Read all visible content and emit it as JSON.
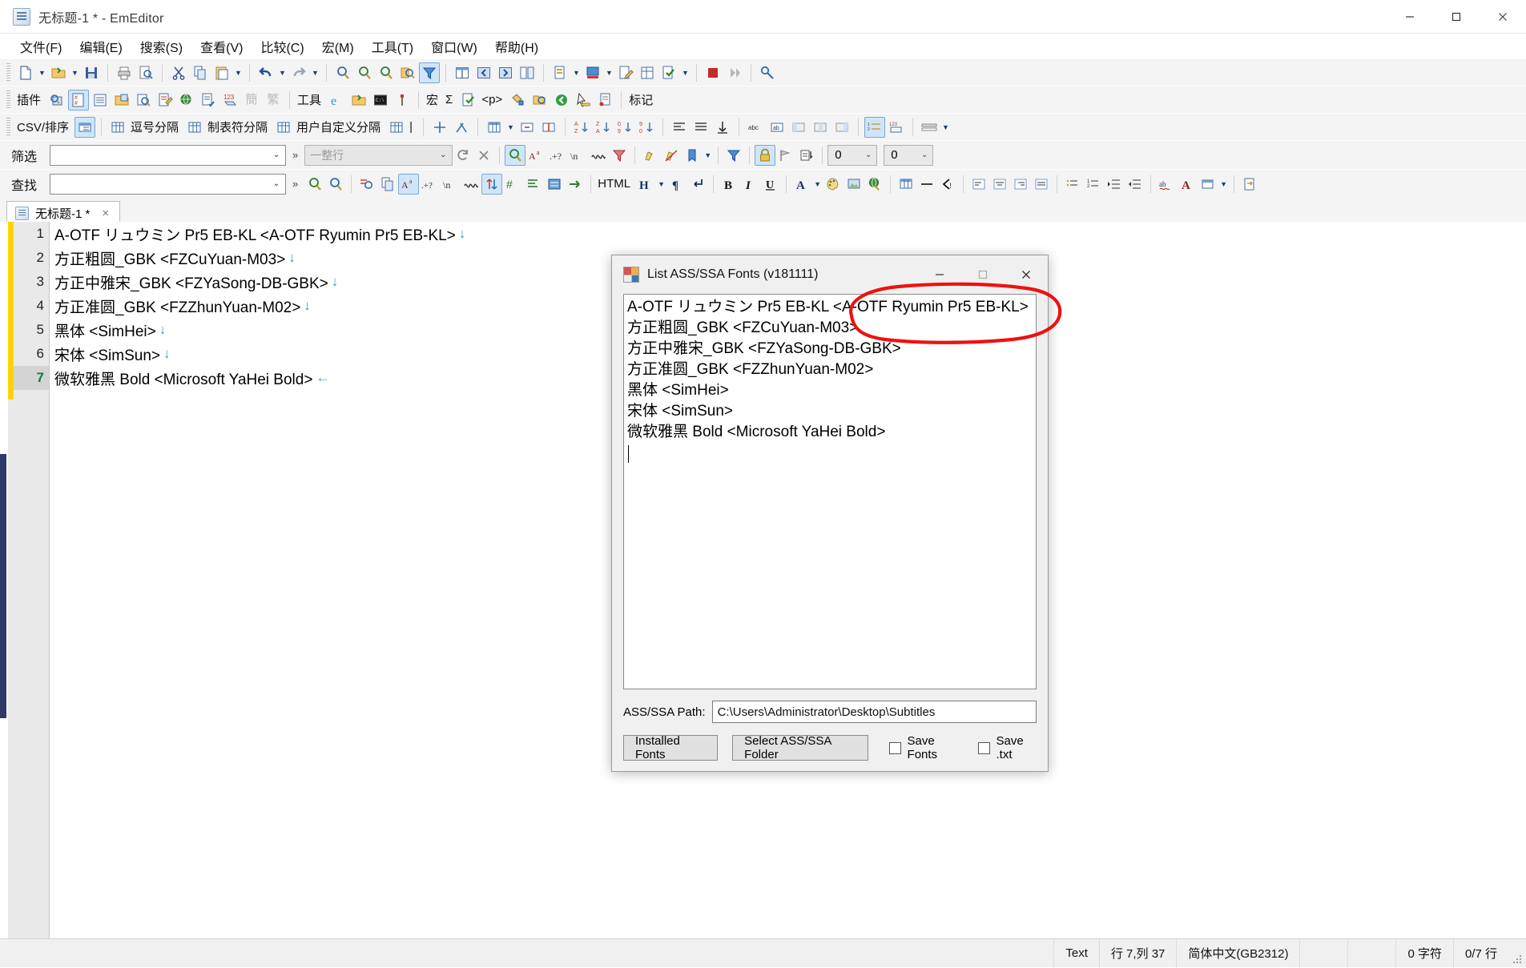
{
  "window": {
    "title": "无标题-1 * - EmEditor",
    "icon": "notepad-icon",
    "minimize": "minimize",
    "maximize": "maximize",
    "close": "close"
  },
  "menubar": {
    "items": [
      {
        "label": "文件(F)"
      },
      {
        "label": "编辑(E)"
      },
      {
        "label": "搜索(S)"
      },
      {
        "label": "查看(V)"
      },
      {
        "label": "比较(C)"
      },
      {
        "label": "宏(M)"
      },
      {
        "label": "工具(T)"
      },
      {
        "label": "窗口(W)"
      },
      {
        "label": "帮助(H)"
      }
    ]
  },
  "toolbar_standard": {
    "icons": [
      "new-file-icon",
      "new-file-dropdown",
      "open-folder-icon",
      "open-dropdown",
      "save-icon",
      "print-icon",
      "print-preview-icon",
      "cut-icon",
      "copy-icon",
      "paste-icon",
      "paste-dropdown",
      "undo-icon",
      "undo-dropdown",
      "redo-icon",
      "redo-dropdown",
      "find-icon",
      "find-next-icon",
      "find-prev-icon",
      "find-in-files-icon",
      "filter-icon",
      "split-icon",
      "prev-doc-icon",
      "next-doc-icon",
      "compare-icon",
      "insert-icon",
      "insert-dropdown",
      "color-icon",
      "color-dropdown",
      "edit-icon",
      "cell-icon",
      "checkmark-icon",
      "checkmark-dropdown",
      "stop-icon",
      "play-icon",
      "wand-icon"
    ]
  },
  "toolbar_plugins": {
    "group_label": "插件",
    "tools_label": "工具",
    "macro_label": "宏",
    "mark_label": "标记",
    "macro_sigma": "Σ",
    "html_tag": "<p>",
    "icons": [
      "plugin-search-icon",
      "plugin-csv-icon",
      "plugin-outline-icon",
      "plugin-explorer-icon",
      "plugin-preview-icon",
      "plugin-snippet-icon",
      "plugin-web-icon",
      "plugin-project-icon",
      "plugin-number-icon",
      "simplified-icon",
      "traditional-icon",
      "ie-browser-icon",
      "open-folder2-icon",
      "console-icon",
      "hammer-icon",
      "macro-run-icon",
      "macro-tag-icon",
      "macro-edit-icon",
      "macro-select-icon",
      "macro-back-icon",
      "macro-cursor-icon",
      "macro-clip-icon"
    ]
  },
  "toolbar_csv": {
    "group_label": "CSV/排序",
    "items": [
      {
        "label": "",
        "icon": "csv-mode-icon",
        "active": true
      },
      {
        "label": "逗号分隔",
        "icon": "grid-icon"
      },
      {
        "label": "制表符分隔",
        "icon": "grid-icon"
      },
      {
        "label": "用户自定义分隔",
        "icon": "grid-icon"
      },
      {
        "label": "|",
        "icon": "grid-icon"
      }
    ],
    "icons": [
      "insert-col-icon",
      "sort-tools-icon",
      "column-dropdown-icon",
      "merge-icon",
      "split-cell-icon",
      "undo-sort-icon",
      "sort-az-icon",
      "sort-za-icon",
      "sort-09-icon",
      "sort-90-icon",
      "align-left-icon",
      "align-justify-icon",
      "sort-down-icon",
      "abc-icon",
      "abc2-icon",
      "col-a-icon",
      "col-b-icon",
      "col-c-icon",
      "numbered-icon",
      "num123-icon",
      "dots-icon"
    ]
  },
  "filter_bar": {
    "label": "筛选",
    "value": "",
    "placeholder": "",
    "scope_label": "一整行",
    "refresh_icon": "refresh-icon",
    "clear_icon": "clear-icon",
    "spinner_left": "0",
    "spinner_right": "0",
    "icons": [
      "zoom-filter-icon",
      "match-case-icon",
      "regex-icon",
      "escape-icon",
      "wrap-icon",
      "filter-off-icon",
      "highlight-icon",
      "highlight-off-icon",
      "bookmark-dropdown-icon",
      "funnel-icon",
      "lock-icon",
      "flag-icon",
      "calc-icon"
    ]
  },
  "find_bar": {
    "label": "查找",
    "value": "",
    "placeholder": "",
    "html_label": "HTML",
    "icons": [
      "find-prev-icon",
      "find-next-icon",
      "find-all-icon",
      "copy-all-icon",
      "match-case-icon",
      "regex-icon",
      "escape-icon",
      "wrap-icon",
      "updown-icon",
      "hash-icon",
      "list-icon",
      "select-icon",
      "goto-icon",
      "heading-icon",
      "heading-dropdown",
      "paragraph-icon",
      "linebreak-icon",
      "bold-icon",
      "italic-icon",
      "underline-icon",
      "font-color-icon",
      "font-dropdown",
      "palette-icon",
      "image-icon",
      "link-icon",
      "table-icon",
      "hr-icon",
      "comment-icon",
      "indent-icon",
      "align-left-icon",
      "align-center-icon",
      "align-right-icon",
      "align-justify-icon",
      "bullet-list-icon",
      "number-list-icon",
      "indent-inc-icon",
      "indent-dec-icon",
      "spell-icon",
      "font-a-icon",
      "font-box-icon",
      "font-box-dropdown",
      "export-icon"
    ]
  },
  "tab": {
    "label": "无标题-1 *",
    "close": "×",
    "icon": "document-icon"
  },
  "editor": {
    "lines": [
      {
        "num": "1",
        "text": "A-OTF リュウミン Pr5 EB-KL <A-OTF Ryumin Pr5 EB-KL>",
        "eol": "↓",
        "current": false
      },
      {
        "num": "2",
        "text": "方正粗圆_GBK <FZCuYuan-M03>",
        "eol": "↓",
        "current": false
      },
      {
        "num": "3",
        "text": "方正中雅宋_GBK <FZYaSong-DB-GBK>",
        "eol": "↓",
        "current": false
      },
      {
        "num": "4",
        "text": "方正准圆_GBK <FZZhunYuan-M02>",
        "eol": "↓",
        "current": false
      },
      {
        "num": "5",
        "text": "黑体 <SimHei>",
        "eol": "↓",
        "current": false
      },
      {
        "num": "6",
        "text": "宋体 <SimSun>",
        "eol": "↓",
        "current": false
      },
      {
        "num": "7",
        "text": "微软雅黑 Bold <Microsoft YaHei Bold>",
        "eol": "←",
        "current": true
      }
    ]
  },
  "statusbar": {
    "type": "Text",
    "position": "行 7,列 37",
    "encoding": "简体中文(GB2312)",
    "chars": "0 字符",
    "lines": "0/7 行"
  },
  "dialog": {
    "title": "List ASS/SSA Fonts (v181111)",
    "icon": "app-tiles-icon",
    "minimize": "minimize",
    "maximize": "maximize",
    "close": "close",
    "list": [
      "A-OTF リュウミン Pr5 EB-KL <A-OTF Ryumin Pr5 EB-KL>",
      "方正粗圆_GBK <FZCuYuan-M03>",
      "方正中雅宋_GBK <FZYaSong-DB-GBK>",
      "方正准圆_GBK <FZZhunYuan-M02>",
      "黑体 <SimHei>",
      "宋体 <SimSun>",
      "微软雅黑 Bold <Microsoft YaHei Bold>"
    ],
    "path_label": "ASS/SSA Path:",
    "path_value": "C:\\Users\\Administrator\\Desktop\\Subtitles",
    "installed_fonts_button": "Installed Fonts",
    "select_folder_button": "Select ASS/SSA Folder",
    "save_fonts_checkbox": "Save Fonts",
    "save_fonts_checked": false,
    "save_txt_checkbox": "Save .txt",
    "save_txt_checked": false
  },
  "annotation": {
    "shape": "red-ellipse",
    "color": "#ee1111",
    "targets": "<A-OTF Ryumin P"
  },
  "colors": {
    "accent": "#2b3a6b",
    "bookmark_yellow": "#ffd400",
    "current_line_num": "#127a3c",
    "eol_marker": "#4a90d9",
    "annotation_red": "#ee1111"
  }
}
